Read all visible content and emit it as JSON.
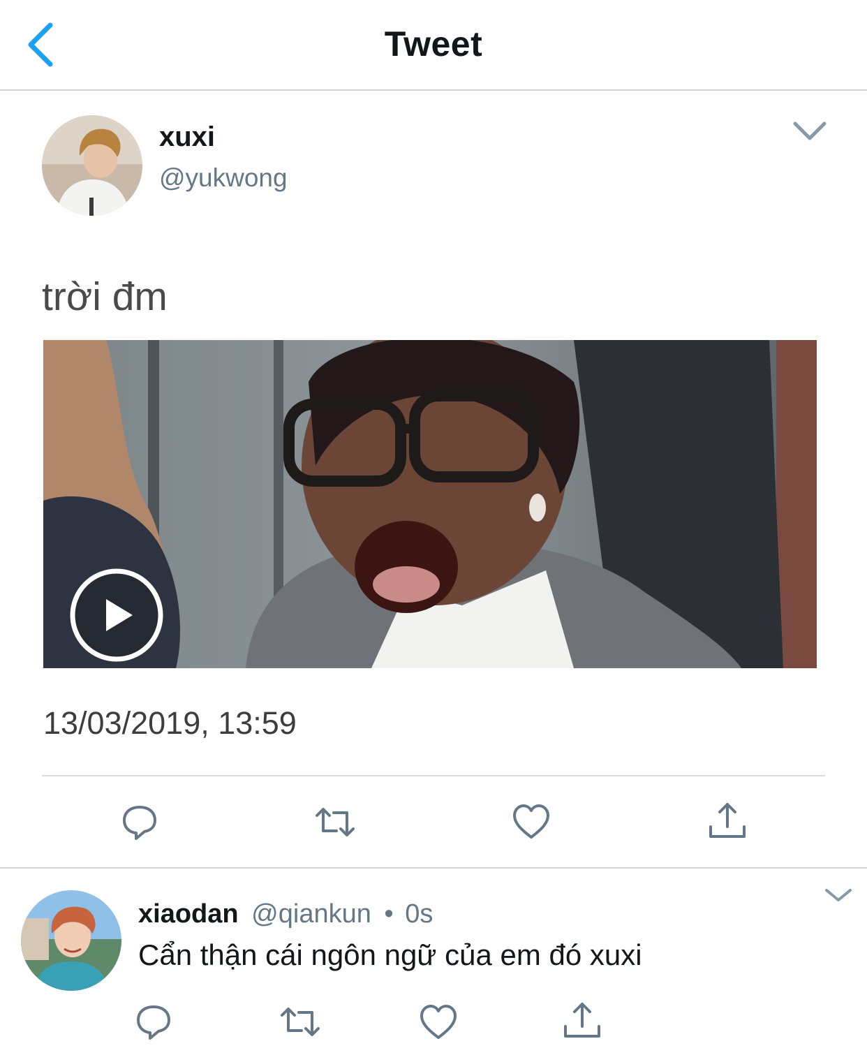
{
  "nav": {
    "title": "Tweet",
    "back_icon": "chevron-left-icon"
  },
  "tweet": {
    "author_name": "xuxi",
    "author_handle": "@yukwong",
    "text": "trời đm",
    "timestamp": "13/03/2019, 13:59",
    "media": {
      "type": "video",
      "play_icon": "play-icon"
    },
    "actions": [
      "reply-icon",
      "retweet-icon",
      "like-icon",
      "share-icon"
    ]
  },
  "reply": {
    "author_name": "xiaodan",
    "author_handle": "@qiankun",
    "separator": "•",
    "time": "0s",
    "text": "Cẩn thận cái ngôn ngữ của em đó xuxi",
    "actions": [
      "reply-icon",
      "retweet-icon",
      "like-icon",
      "share-icon"
    ]
  },
  "colors": {
    "accent": "#1da1f2",
    "icon_gray": "#657786",
    "divider": "#d7dbde"
  }
}
